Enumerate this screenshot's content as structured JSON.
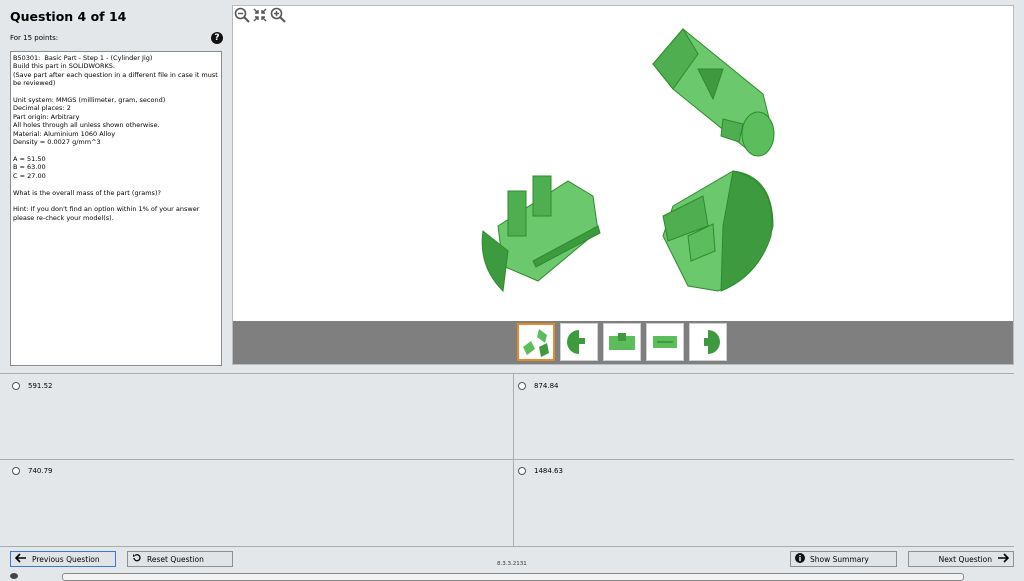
{
  "header": {
    "title": "Question 4 of 14",
    "points": "For 15 points:"
  },
  "question_text": "B50301:  Basic Part - Step 1 - (Cylinder Jig)\nBuild this part in SOLIDWORKS.\n(Save part after each question in a different file in case it must be reviewed)\n\nUnit system: MMGS (millimeter, gram, second)\nDecimal places: 2\nPart origin: Arbitrary\nAll holes through all unless shown otherwise.\nMaterial: Aluminium 1060 Alloy\nDensity = 0.0027 g/mm^3\n\nA = 51.50\nB = 63.00\nC = 27.00\n\nWhat is the overall mass of the part (grams)?\n\nHint: If you don't find an option within 1% of your answer please re-check your model(s).",
  "viewer": {
    "zoom_tools": [
      "zoom-out-icon",
      "fit-icon",
      "zoom-in-icon"
    ],
    "thumbnails": [
      "isometric-views",
      "side-view",
      "front-view",
      "top-view",
      "end-view"
    ],
    "active_thumbnail": 0,
    "part_color": "#5cbd5c"
  },
  "answers": [
    {
      "label": "591.52"
    },
    {
      "label": "874.84"
    },
    {
      "label": "740.79"
    },
    {
      "label": "1484.63"
    }
  ],
  "footer": {
    "previous": "Previous Question",
    "reset": "Reset Question",
    "version": "8.3.3.2131",
    "summary": "Show Summary",
    "next": "Next Question"
  }
}
